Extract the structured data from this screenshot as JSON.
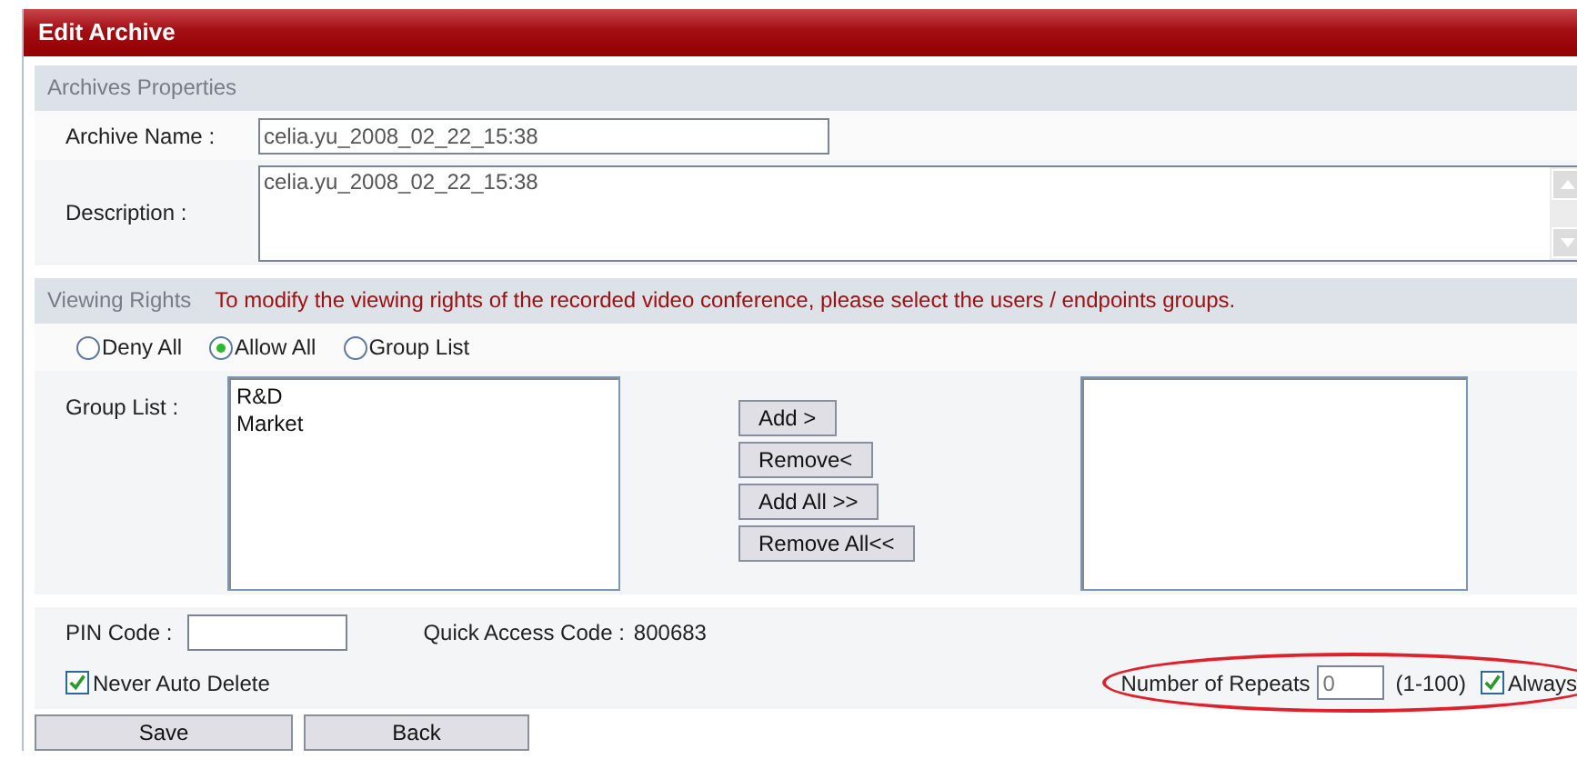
{
  "window": {
    "title": "Edit Archive"
  },
  "properties": {
    "header": "Archives Properties",
    "archive_name": {
      "label": "Archive Name :",
      "value": "celia.yu_2008_02_22_15:38"
    },
    "description": {
      "label": "Description :",
      "value": "celia.yu_2008_02_22_15:38"
    }
  },
  "viewing_rights": {
    "header": "Viewing Rights",
    "note": "To modify the viewing rights of the recorded video conference, please select the users / endpoints groups.",
    "options": [
      {
        "label": "Deny All",
        "selected": false
      },
      {
        "label": "Allow All",
        "selected": true
      },
      {
        "label": "Group List",
        "selected": false
      }
    ],
    "group_list_label": "Group List :",
    "available": [
      "R&D",
      "Market"
    ],
    "buttons": [
      "Add >",
      "Remove<",
      "Add All >>",
      "Remove All<<"
    ]
  },
  "pin_code": {
    "label": "PIN Code :"
  },
  "quick_access": {
    "label": "Quick Access Code :",
    "value": "800683"
  },
  "never_auto_delete": {
    "label": "Never Auto Delete",
    "checked": true
  },
  "repeats": {
    "label": "Number of Repeats",
    "placeholder": "0",
    "range": "(1-100)",
    "always": {
      "label": "Always",
      "checked": true
    },
    "circled": true
  },
  "actions": [
    "Save",
    "Back"
  ]
}
